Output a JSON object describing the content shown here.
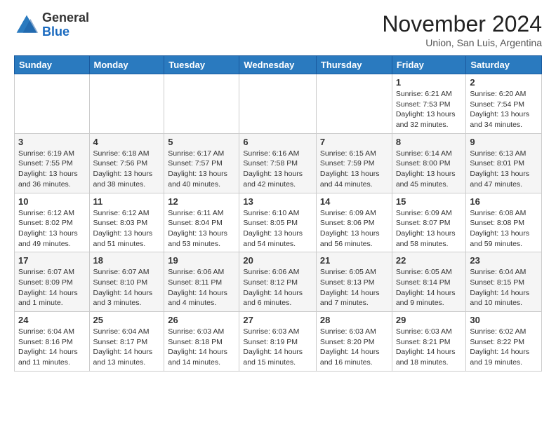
{
  "logo": {
    "general": "General",
    "blue": "Blue"
  },
  "header": {
    "month": "November 2024",
    "location": "Union, San Luis, Argentina"
  },
  "days_of_week": [
    "Sunday",
    "Monday",
    "Tuesday",
    "Wednesday",
    "Thursday",
    "Friday",
    "Saturday"
  ],
  "weeks": [
    [
      {
        "day": "",
        "info": ""
      },
      {
        "day": "",
        "info": ""
      },
      {
        "day": "",
        "info": ""
      },
      {
        "day": "",
        "info": ""
      },
      {
        "day": "",
        "info": ""
      },
      {
        "day": "1",
        "info": "Sunrise: 6:21 AM\nSunset: 7:53 PM\nDaylight: 13 hours\nand 32 minutes."
      },
      {
        "day": "2",
        "info": "Sunrise: 6:20 AM\nSunset: 7:54 PM\nDaylight: 13 hours\nand 34 minutes."
      }
    ],
    [
      {
        "day": "3",
        "info": "Sunrise: 6:19 AM\nSunset: 7:55 PM\nDaylight: 13 hours\nand 36 minutes."
      },
      {
        "day": "4",
        "info": "Sunrise: 6:18 AM\nSunset: 7:56 PM\nDaylight: 13 hours\nand 38 minutes."
      },
      {
        "day": "5",
        "info": "Sunrise: 6:17 AM\nSunset: 7:57 PM\nDaylight: 13 hours\nand 40 minutes."
      },
      {
        "day": "6",
        "info": "Sunrise: 6:16 AM\nSunset: 7:58 PM\nDaylight: 13 hours\nand 42 minutes."
      },
      {
        "day": "7",
        "info": "Sunrise: 6:15 AM\nSunset: 7:59 PM\nDaylight: 13 hours\nand 44 minutes."
      },
      {
        "day": "8",
        "info": "Sunrise: 6:14 AM\nSunset: 8:00 PM\nDaylight: 13 hours\nand 45 minutes."
      },
      {
        "day": "9",
        "info": "Sunrise: 6:13 AM\nSunset: 8:01 PM\nDaylight: 13 hours\nand 47 minutes."
      }
    ],
    [
      {
        "day": "10",
        "info": "Sunrise: 6:12 AM\nSunset: 8:02 PM\nDaylight: 13 hours\nand 49 minutes."
      },
      {
        "day": "11",
        "info": "Sunrise: 6:12 AM\nSunset: 8:03 PM\nDaylight: 13 hours\nand 51 minutes."
      },
      {
        "day": "12",
        "info": "Sunrise: 6:11 AM\nSunset: 8:04 PM\nDaylight: 13 hours\nand 53 minutes."
      },
      {
        "day": "13",
        "info": "Sunrise: 6:10 AM\nSunset: 8:05 PM\nDaylight: 13 hours\nand 54 minutes."
      },
      {
        "day": "14",
        "info": "Sunrise: 6:09 AM\nSunset: 8:06 PM\nDaylight: 13 hours\nand 56 minutes."
      },
      {
        "day": "15",
        "info": "Sunrise: 6:09 AM\nSunset: 8:07 PM\nDaylight: 13 hours\nand 58 minutes."
      },
      {
        "day": "16",
        "info": "Sunrise: 6:08 AM\nSunset: 8:08 PM\nDaylight: 13 hours\nand 59 minutes."
      }
    ],
    [
      {
        "day": "17",
        "info": "Sunrise: 6:07 AM\nSunset: 8:09 PM\nDaylight: 14 hours\nand 1 minute."
      },
      {
        "day": "18",
        "info": "Sunrise: 6:07 AM\nSunset: 8:10 PM\nDaylight: 14 hours\nand 3 minutes."
      },
      {
        "day": "19",
        "info": "Sunrise: 6:06 AM\nSunset: 8:11 PM\nDaylight: 14 hours\nand 4 minutes."
      },
      {
        "day": "20",
        "info": "Sunrise: 6:06 AM\nSunset: 8:12 PM\nDaylight: 14 hours\nand 6 minutes."
      },
      {
        "day": "21",
        "info": "Sunrise: 6:05 AM\nSunset: 8:13 PM\nDaylight: 14 hours\nand 7 minutes."
      },
      {
        "day": "22",
        "info": "Sunrise: 6:05 AM\nSunset: 8:14 PM\nDaylight: 14 hours\nand 9 minutes."
      },
      {
        "day": "23",
        "info": "Sunrise: 6:04 AM\nSunset: 8:15 PM\nDaylight: 14 hours\nand 10 minutes."
      }
    ],
    [
      {
        "day": "24",
        "info": "Sunrise: 6:04 AM\nSunset: 8:16 PM\nDaylight: 14 hours\nand 11 minutes."
      },
      {
        "day": "25",
        "info": "Sunrise: 6:04 AM\nSunset: 8:17 PM\nDaylight: 14 hours\nand 13 minutes."
      },
      {
        "day": "26",
        "info": "Sunrise: 6:03 AM\nSunset: 8:18 PM\nDaylight: 14 hours\nand 14 minutes."
      },
      {
        "day": "27",
        "info": "Sunrise: 6:03 AM\nSunset: 8:19 PM\nDaylight: 14 hours\nand 15 minutes."
      },
      {
        "day": "28",
        "info": "Sunrise: 6:03 AM\nSunset: 8:20 PM\nDaylight: 14 hours\nand 16 minutes."
      },
      {
        "day": "29",
        "info": "Sunrise: 6:03 AM\nSunset: 8:21 PM\nDaylight: 14 hours\nand 18 minutes."
      },
      {
        "day": "30",
        "info": "Sunrise: 6:02 AM\nSunset: 8:22 PM\nDaylight: 14 hours\nand 19 minutes."
      }
    ]
  ]
}
